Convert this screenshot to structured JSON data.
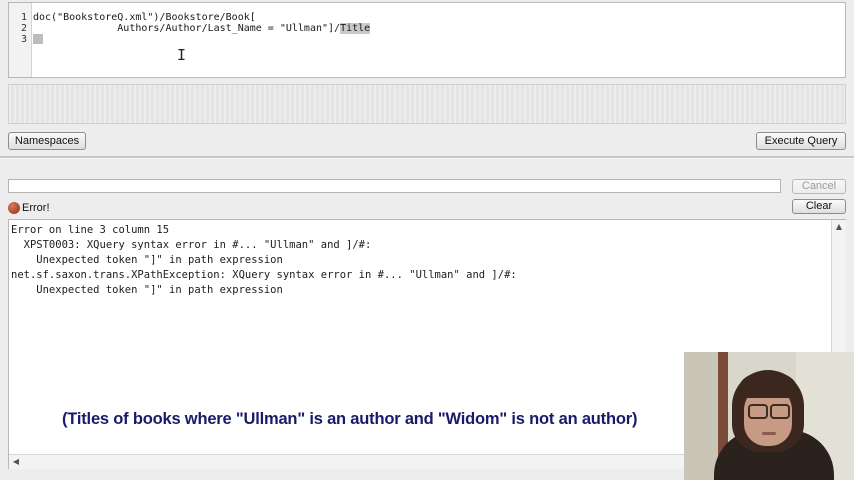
{
  "editor": {
    "line_numbers": [
      "1",
      "2",
      "3"
    ],
    "line1": "doc(\"BookstoreQ.xml\")/Bookstore/Book[",
    "line2_prefix": "              Authors/Author/Last_Name = \"Ullman\"",
    "line2_bracket": "]",
    "line2_sep": "/",
    "line2_highlight": "Title"
  },
  "toolbar": {
    "namespaces_label": "Namespaces",
    "execute_label": "Execute Query"
  },
  "status": {
    "cancel_label": "Cancel",
    "error_label": "Error!",
    "clear_label": "Clear"
  },
  "output": {
    "lines": [
      "Error on line 3 column 15",
      "  XPST0003: XQuery syntax error in #... \"Ullman\" and ]/#:",
      "    Unexpected token \"]\" in path expression",
      "net.sf.saxon.trans.XPathException: XQuery syntax error in #... \"Ullman\" and ]/#:",
      "    Unexpected token \"]\" in path expression"
    ]
  },
  "caption": "(Titles of books where \"Ullman\" is an author and \"Widom\" is not an author)",
  "icons": {
    "error": "error-orb-icon",
    "scroll_up": "triangle-up",
    "scroll_down": "triangle-down",
    "scroll_left": "triangle-left",
    "scroll_right": "triangle-right"
  },
  "colors": {
    "caption": "#1b1a6a",
    "error_icon": "#8d2d16"
  }
}
